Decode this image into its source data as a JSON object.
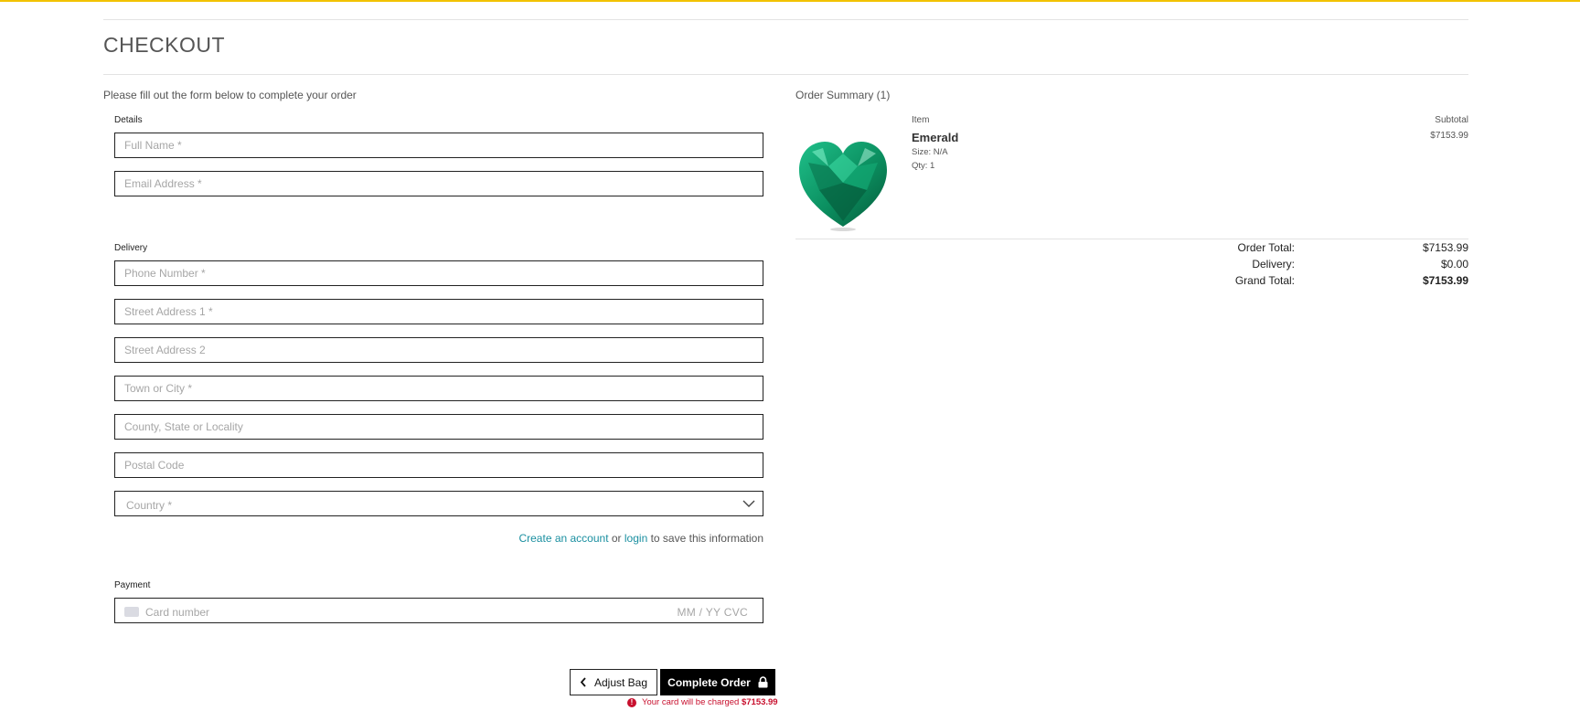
{
  "page": {
    "title": "CHECKOUT",
    "intro": "Please fill out the form below to complete your order"
  },
  "form": {
    "details_label": "Details",
    "full_name_placeholder": "Full Name *",
    "email_placeholder": "Email Address *",
    "delivery_label": "Delivery",
    "phone_placeholder": "Phone Number *",
    "street1_placeholder": "Street Address 1 *",
    "street2_placeholder": "Street Address 2",
    "town_placeholder": "Town or City *",
    "county_placeholder": "County, State or Locality",
    "postcode_placeholder": "Postal Code",
    "country_placeholder": "Country *",
    "account": {
      "create_link": "Create an account",
      "or": "or",
      "login_link": "login",
      "suffix": "to save this information"
    },
    "payment_label": "Payment",
    "card_placeholder": "Card number",
    "card_expiry_cvc": "MM / YY  CVC"
  },
  "actions": {
    "adjust_bag": "Adjust Bag",
    "complete_order": "Complete Order",
    "charge_prefix": "Your card will be charged",
    "charge_amount": "$7153.99"
  },
  "summary": {
    "title": "Order Summary (1)",
    "col_item": "Item",
    "col_subtotal": "Subtotal",
    "item": {
      "name": "Emerald",
      "size": "Size: N/A",
      "qty": "Qty: 1",
      "subtotal": "$7153.99"
    },
    "totals": {
      "order_total_label": "Order Total:",
      "order_total": "$7153.99",
      "delivery_label": "Delivery:",
      "delivery": "$0.00",
      "grand_total_label": "Grand Total:",
      "grand_total": "$7153.99"
    }
  },
  "colors": {
    "accent_line": "#f2c200",
    "link": "#1a8fa0",
    "warning": "#c8102e",
    "emerald": "#0f9c6b"
  }
}
